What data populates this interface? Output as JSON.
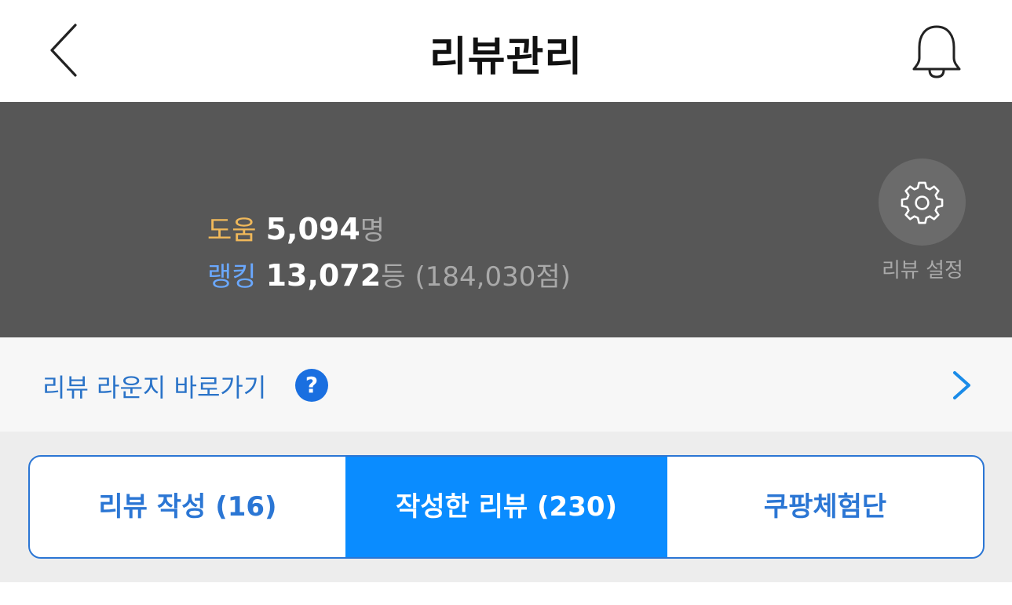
{
  "header": {
    "title": "리뷰관리",
    "back_icon": "chevron-left-icon",
    "bell_icon": "bell-icon"
  },
  "stats": {
    "help_label": "도움",
    "help_value": "5,094",
    "help_unit": "명",
    "rank_label": "랭킹",
    "rank_value": "13,072",
    "rank_unit": "등",
    "rank_points": "(184,030점)",
    "settings_icon": "gear-icon",
    "settings_label": "리뷰 설정"
  },
  "lounge": {
    "label": "리뷰 라운지 바로가기",
    "help_icon_glyph": "?",
    "chevron_icon": "chevron-right-icon"
  },
  "tabs": [
    {
      "label": "리뷰 작성 (16)",
      "selected": false
    },
    {
      "label": "작성한 리뷰 (230)",
      "selected": true
    },
    {
      "label": "쿠팡체험단",
      "selected": false
    }
  ],
  "colors": {
    "banner_bg": "#575757",
    "help_label": "#f1b95a",
    "rank_label": "#6aa8ff",
    "link_blue": "#2a73c8",
    "tab_border": "#2b76d4",
    "tab_active_bg": "#0a8cff"
  }
}
